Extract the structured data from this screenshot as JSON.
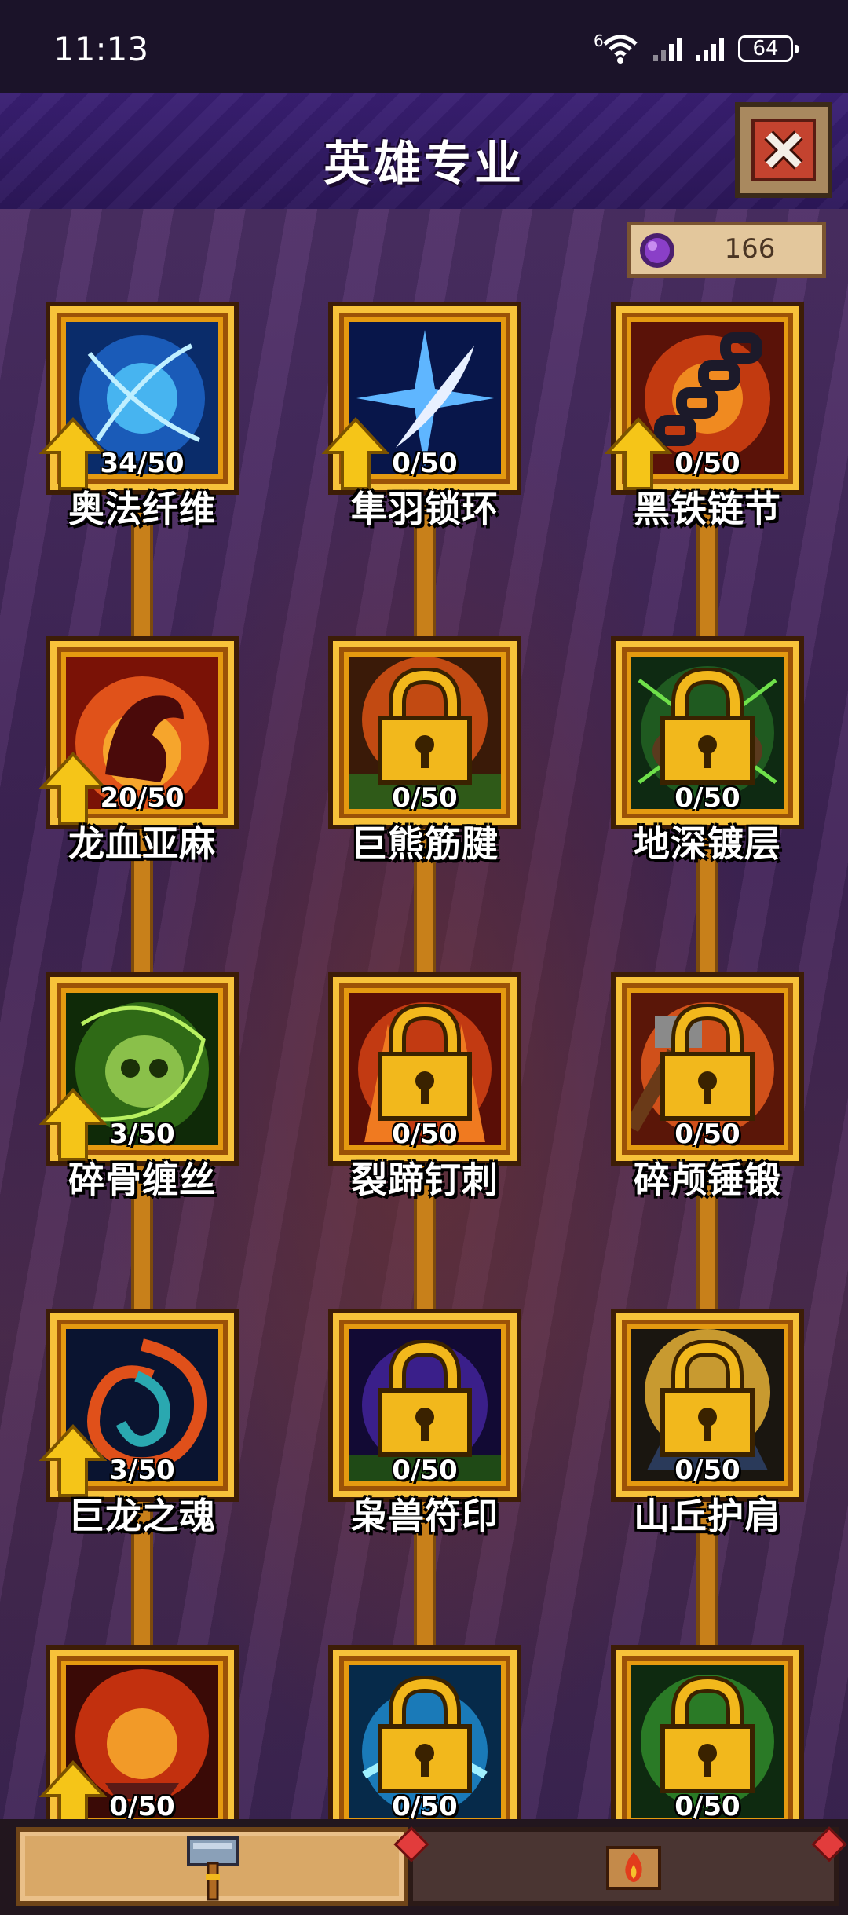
{
  "status_bar": {
    "time": "11:13",
    "wifi_badge": "6",
    "battery": "64"
  },
  "header": {
    "title": "英雄专业",
    "close_icon": "close-x-icon"
  },
  "currency": {
    "icon": "purple-crystal-icon",
    "value": "166"
  },
  "skills": [
    {
      "name": "奥法纤维",
      "progress": "34/50",
      "locked": false,
      "upgradable": true,
      "art": "arcane-fiber-icon"
    },
    {
      "name": "隼羽锁环",
      "progress": "0/50",
      "locked": false,
      "upgradable": true,
      "art": "falcon-feather-icon"
    },
    {
      "name": "黑铁链节",
      "progress": "0/50",
      "locked": false,
      "upgradable": true,
      "art": "black-iron-chain-icon"
    },
    {
      "name": "龙血亚麻",
      "progress": "20/50",
      "locked": false,
      "upgradable": true,
      "art": "dragon-blood-icon"
    },
    {
      "name": "巨熊筋腱",
      "progress": "0/50",
      "locked": true,
      "upgradable": false,
      "art": "bear-tendon-icon"
    },
    {
      "name": "地深镀层",
      "progress": "0/50",
      "locked": true,
      "upgradable": false,
      "art": "deep-earth-plating-icon"
    },
    {
      "name": "碎骨缠丝",
      "progress": "3/50",
      "locked": false,
      "upgradable": true,
      "art": "bone-thread-skull-icon"
    },
    {
      "name": "裂蹄钉刺",
      "progress": "0/50",
      "locked": true,
      "upgradable": false,
      "art": "hoof-spike-icon"
    },
    {
      "name": "碎颅锤锻",
      "progress": "0/50",
      "locked": true,
      "upgradable": false,
      "art": "skull-hammer-icon"
    },
    {
      "name": "巨龙之魂",
      "progress": "3/50",
      "locked": false,
      "upgradable": true,
      "art": "dragon-soul-icon"
    },
    {
      "name": "枭兽符印",
      "progress": "0/50",
      "locked": true,
      "upgradable": false,
      "art": "owlbeast-sigil-icon"
    },
    {
      "name": "山丘护肩",
      "progress": "0/50",
      "locked": true,
      "upgradable": false,
      "art": "hill-pauldron-icon"
    },
    {
      "name": "",
      "progress": "0/50",
      "locked": false,
      "upgradable": true,
      "art": "anvil-fire-icon"
    },
    {
      "name": "",
      "progress": "0/50",
      "locked": true,
      "upgradable": false,
      "art": "water-swirl-icon"
    },
    {
      "name": "",
      "progress": "0/50",
      "locked": true,
      "upgradable": false,
      "art": "green-gem-icon"
    }
  ],
  "bottom_tabs": [
    {
      "icon": "hammer-icon",
      "active": true
    },
    {
      "icon": "fire-scroll-icon",
      "active": false
    }
  ],
  "colors": {
    "header_purple": "#3a1f74",
    "frame_gold": "#e59a10",
    "close_red": "#c4432f",
    "upgrade_arrow": "#f5c518"
  }
}
